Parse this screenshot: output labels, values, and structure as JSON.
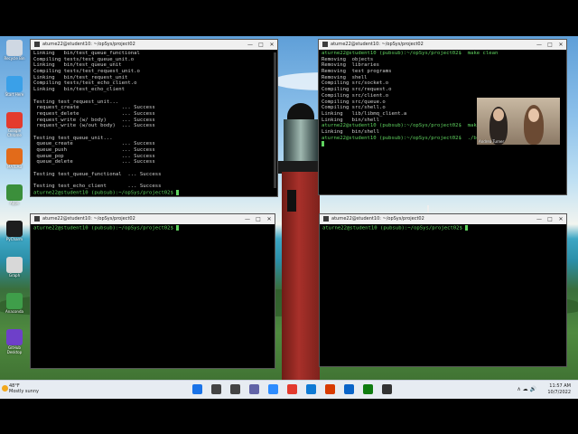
{
  "desktop_icons": [
    {
      "label": "Recycle Bin",
      "icon": "recycle-bin-icon",
      "color": "#cfd8e3"
    },
    {
      "label": "Start Here",
      "icon": "windows-app-icon",
      "color": "#3aa0e8"
    },
    {
      "label": "Google Chrome",
      "icon": "chrome-icon",
      "color": "#e33b2e"
    },
    {
      "label": "MATLAB",
      "icon": "matlab-icon",
      "color": "#e26b1a"
    },
    {
      "label": "Apps",
      "icon": "apps-icon",
      "color": "#3b8f3b"
    },
    {
      "label": "PyCharm",
      "icon": "pycharm-icon",
      "color": "#1d1d1d"
    },
    {
      "label": "Graph",
      "icon": "graph-icon",
      "color": "#d8d8d8"
    },
    {
      "label": "Anaconda",
      "icon": "anaconda-icon",
      "color": "#3f9e4a"
    },
    {
      "label": "GitHub Desktop",
      "icon": "github-icon",
      "color": "#6e40c9"
    }
  ],
  "terminals": [
    {
      "title": "aturne22@student10: ~/opSys/project02",
      "lines": [
        "Linking   bin/test_queue_functional",
        "Compiling tests/test_queue_unit.o",
        "Linking   bin/test_queue_unit",
        "Compiling tests/test_request_unit.o",
        "Linking   bin/test_request_unit",
        "Compiling tests/test_echo_client.o",
        "Linking   bin/test_echo_client",
        "",
        "Testing test_request_unit...",
        " request_create              ... Success",
        " request_delete              ... Success",
        " request_write (w/ body)     ... Success",
        " request_write (w/out body)  ... Success",
        "",
        "Testing test_queue_unit...",
        " queue_create                ... Success",
        " queue_push                  ... Success",
        " queue_pop                   ... Success",
        " queue_delete                ... Success",
        "",
        "Testing test_queue_functional  ... Success",
        "",
        "Testing test_echo_client       ... Success"
      ],
      "prompt": "aturne22@student10 (pubsub):~/opSys/project02$"
    },
    {
      "title": "aturne22@student10: ~/opSys/project02",
      "lines": [
        "aturne22@student10 (pubsub):~/opSys/project02$  make clean",
        "Removing  objects",
        "Removing  libraries",
        "Removing  test programs",
        "Removing  shell",
        "Compiling src/socket.o",
        "Compiling src/request.o",
        "Compiling src/client.o",
        "Compiling src/queue.o",
        "Compiling src/shell.o",
        "Linking   lib/libmq_client.a",
        "Linking   bin/shell",
        "aturne22@student10 (pubsub):~/opSys/project02$  make bin/shell",
        "Linking   bin/shell",
        "aturne22@student10 (pubsub):~/opSys/project02$  ./bin/mq_server.py --port=9457"
      ],
      "prompt": ""
    },
    {
      "title": "aturne22@student10: ~/opSys/project02",
      "lines": [],
      "prompt": "aturne22@student10 (pubsub):~/opSys/project02$"
    },
    {
      "title": "aturne22@student10: ~/opSys/project02",
      "lines": [],
      "prompt": "aturne22@student10 (pubsub):~/opSys/project02$"
    }
  ],
  "window_controls": {
    "minimize": "—",
    "maximize": "□",
    "close": "✕"
  },
  "video": {
    "label": "Andrea Turner"
  },
  "taskbar": {
    "weather_temp": "48°F",
    "weather_desc": "Mostly sunny",
    "time": "11:57 AM",
    "date": "10/7/2022",
    "tray": "∧  ☁  🔊",
    "apps": [
      {
        "icon": "windows-start-icon",
        "color": "#1a73e8"
      },
      {
        "icon": "search-icon",
        "color": "#444444"
      },
      {
        "icon": "task-view-icon",
        "color": "#444444"
      },
      {
        "icon": "teams-chat-icon",
        "color": "#6264a7"
      },
      {
        "icon": "zoom-icon",
        "color": "#2d8cff"
      },
      {
        "icon": "chrome-icon",
        "color": "#e33b2e"
      },
      {
        "icon": "edge-icon",
        "color": "#0f7bd4"
      },
      {
        "icon": "office-icon",
        "color": "#d83b01"
      },
      {
        "icon": "outlook-icon",
        "color": "#0a64c8"
      },
      {
        "icon": "xbox-icon",
        "color": "#107c10"
      },
      {
        "icon": "terminal-icon",
        "color": "#333333"
      }
    ]
  }
}
